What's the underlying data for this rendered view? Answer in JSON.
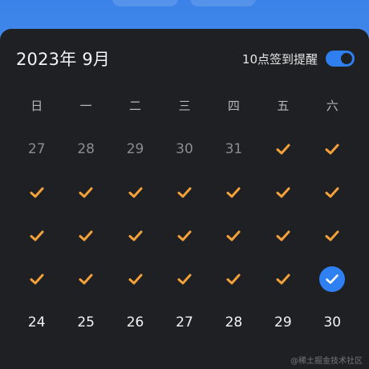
{
  "calendar": {
    "title": "2023年 9月",
    "reminder_label": "10点签到提醒",
    "reminder_enabled": true,
    "weekdays": [
      "日",
      "一",
      "二",
      "三",
      "四",
      "五",
      "六"
    ],
    "weeks": [
      [
        {
          "label": "27",
          "state": "prev-month"
        },
        {
          "label": "28",
          "state": "prev-month"
        },
        {
          "label": "29",
          "state": "prev-month"
        },
        {
          "label": "30",
          "state": "prev-month"
        },
        {
          "label": "31",
          "state": "prev-month"
        },
        {
          "label": "",
          "state": "checked"
        },
        {
          "label": "",
          "state": "checked"
        }
      ],
      [
        {
          "label": "",
          "state": "checked"
        },
        {
          "label": "",
          "state": "checked"
        },
        {
          "label": "",
          "state": "checked"
        },
        {
          "label": "",
          "state": "checked"
        },
        {
          "label": "",
          "state": "checked"
        },
        {
          "label": "",
          "state": "checked"
        },
        {
          "label": "",
          "state": "checked"
        }
      ],
      [
        {
          "label": "",
          "state": "checked"
        },
        {
          "label": "",
          "state": "checked"
        },
        {
          "label": "",
          "state": "checked"
        },
        {
          "label": "",
          "state": "checked"
        },
        {
          "label": "",
          "state": "checked"
        },
        {
          "label": "",
          "state": "checked"
        },
        {
          "label": "",
          "state": "checked"
        }
      ],
      [
        {
          "label": "",
          "state": "checked"
        },
        {
          "label": "",
          "state": "checked"
        },
        {
          "label": "",
          "state": "checked"
        },
        {
          "label": "",
          "state": "checked"
        },
        {
          "label": "",
          "state": "checked"
        },
        {
          "label": "",
          "state": "checked"
        },
        {
          "label": "",
          "state": "today-checked"
        }
      ],
      [
        {
          "label": "24",
          "state": "future"
        },
        {
          "label": "25",
          "state": "future"
        },
        {
          "label": "26",
          "state": "future"
        },
        {
          "label": "27",
          "state": "future"
        },
        {
          "label": "28",
          "state": "future"
        },
        {
          "label": "29",
          "state": "future"
        },
        {
          "label": "30",
          "state": "future"
        }
      ]
    ]
  },
  "watermark": "@稀土掘金技术社区",
  "colors": {
    "panel_bg": "#1f2023",
    "accent_blue": "#2f80f2",
    "check_orange": "#f5a13a",
    "muted_text": "#8c8c8f"
  },
  "icons": {
    "checked_day": "checkmark-icon",
    "today": "check-circle-icon"
  }
}
